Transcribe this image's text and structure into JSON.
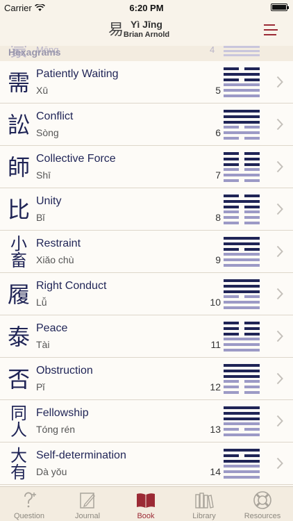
{
  "status": {
    "carrier": "Carrier",
    "time": "6:20 PM"
  },
  "nav": {
    "logo_char": "易",
    "title": "Yì Jīng",
    "subtitle": "Brian Arnold",
    "menu_icon": "menu-icon"
  },
  "peek": {
    "char": "蒙",
    "name": "Mēng",
    "num": "4"
  },
  "section_header": "Hexagrams",
  "colors": {
    "dark": "#1f2456",
    "light": "#9c9ac6",
    "accent": "#9b2a35"
  },
  "hexagrams": [
    {
      "chars": [
        "需"
      ],
      "name": "Patiently Waiting",
      "pinyin": "Xū",
      "num": "5",
      "lines": [
        0,
        1,
        0,
        1,
        1,
        1
      ]
    },
    {
      "chars": [
        "訟"
      ],
      "name": "Conflict",
      "pinyin": "Sòng",
      "num": "6",
      "lines": [
        1,
        1,
        1,
        0,
        1,
        0
      ]
    },
    {
      "chars": [
        "師"
      ],
      "name": "Collective Force",
      "pinyin": "Shī",
      "num": "7",
      "lines": [
        0,
        0,
        0,
        0,
        1,
        0
      ]
    },
    {
      "chars": [
        "比"
      ],
      "name": "Unity",
      "pinyin": "Bǐ",
      "num": "8",
      "lines": [
        0,
        1,
        0,
        0,
        0,
        0
      ]
    },
    {
      "chars": [
        "小",
        "畜"
      ],
      "name": "Restraint",
      "pinyin": "Xiǎo chù",
      "num": "9",
      "lines": [
        1,
        1,
        0,
        1,
        1,
        1
      ]
    },
    {
      "chars": [
        "履"
      ],
      "name": "Right Conduct",
      "pinyin": "Lǚ",
      "num": "10",
      "lines": [
        1,
        1,
        1,
        0,
        1,
        1
      ]
    },
    {
      "chars": [
        "泰"
      ],
      "name": "Peace",
      "pinyin": "Tài",
      "num": "11",
      "lines": [
        0,
        0,
        0,
        1,
        1,
        1
      ]
    },
    {
      "chars": [
        "否"
      ],
      "name": "Obstruction",
      "pinyin": "Pǐ",
      "num": "12",
      "lines": [
        1,
        1,
        1,
        0,
        0,
        0
      ]
    },
    {
      "chars": [
        "同",
        "人"
      ],
      "name": "Fellowship",
      "pinyin": "Tóng rén",
      "num": "13",
      "lines": [
        1,
        1,
        1,
        1,
        0,
        1
      ]
    },
    {
      "chars": [
        "大",
        "有"
      ],
      "name": "Self-determination",
      "pinyin": "Dà yǒu",
      "num": "14",
      "lines": [
        1,
        0,
        1,
        1,
        1,
        1
      ]
    }
  ],
  "tabs": [
    {
      "label": "Question",
      "icon": "question-icon",
      "active": false
    },
    {
      "label": "Journal",
      "icon": "journal-icon",
      "active": false
    },
    {
      "label": "Book",
      "icon": "book-icon",
      "active": true
    },
    {
      "label": "Library",
      "icon": "library-icon",
      "active": false
    },
    {
      "label": "Resources",
      "icon": "lifebuoy-icon",
      "active": false
    }
  ]
}
